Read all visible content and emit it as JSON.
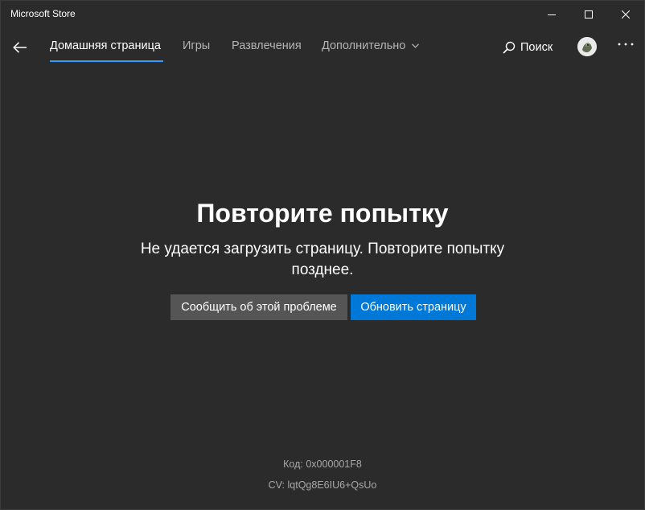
{
  "window": {
    "title": "Microsoft Store"
  },
  "nav": {
    "tabs": [
      {
        "label": "Домашняя страница",
        "active": true
      },
      {
        "label": "Игры",
        "active": false
      },
      {
        "label": "Развлечения",
        "active": false
      },
      {
        "label": "Дополнительно",
        "active": false
      }
    ],
    "search_label": "Поиск",
    "icons": {
      "back": "back-arrow-icon",
      "more_chevron": "chevron-down-icon",
      "search": "search-icon",
      "overflow": "more-dots-icon"
    }
  },
  "error": {
    "title": "Повторите попытку",
    "message": "Не удается загрузить страницу. Повторите попытку позднее.",
    "report_button": "Сообщить об этой проблеме",
    "refresh_button": "Обновить страницу",
    "code": "Код: 0x000001F8",
    "cv": "CV: lqtQg8E6IU6+QsUo"
  },
  "colors": {
    "background": "#2b2b2b",
    "accent": "#0078d7",
    "tab_underline": "#2d9cff",
    "secondary_button": "#555555"
  }
}
